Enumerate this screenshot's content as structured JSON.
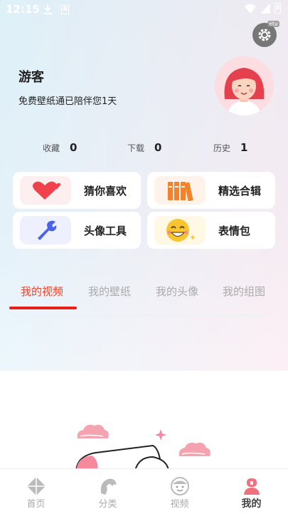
{
  "status_bar": {
    "time": "12:15",
    "battery": "8"
  },
  "settings": {
    "tag": "etv"
  },
  "profile": {
    "username": "游客",
    "vip_text": "免费壁纸通已陪伴您1天"
  },
  "stats": [
    {
      "label": "收藏",
      "value": "0"
    },
    {
      "label": "下载",
      "value": "0"
    },
    {
      "label": "历史",
      "value": "1"
    }
  ],
  "features": [
    {
      "label": "猜你喜欢",
      "icon": "heart-icon",
      "color": "#f0424a"
    },
    {
      "label": "精选合辑",
      "icon": "books-icon",
      "color": "#f2822c"
    },
    {
      "label": "头像工具",
      "icon": "wrench-icon",
      "color": "#4a63e8"
    },
    {
      "label": "表情包",
      "icon": "smiley-icon",
      "color": "#f7c531"
    }
  ],
  "tabs": [
    "我的视频",
    "我的壁纸",
    "我的头像",
    "我的组图"
  ],
  "active_tab": "我的视频",
  "bottom_nav": [
    {
      "label": "首页",
      "icon": "home-diamond-icon"
    },
    {
      "label": "分类",
      "icon": "category-icon"
    },
    {
      "label": "视频",
      "icon": "video-face-icon"
    },
    {
      "label": "我的",
      "icon": "profile-icon"
    }
  ],
  "accent_color": "#e8472f"
}
